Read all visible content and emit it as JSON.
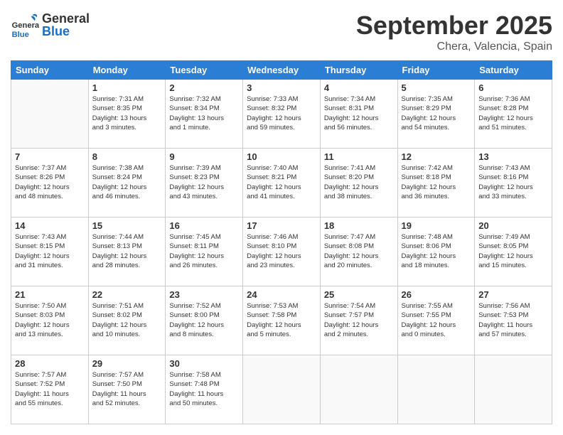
{
  "header": {
    "logo": {
      "general": "General",
      "blue": "Blue",
      "tagline": ""
    },
    "title": "September 2025",
    "subtitle": "Chera, Valencia, Spain"
  },
  "days_of_week": [
    "Sunday",
    "Monday",
    "Tuesday",
    "Wednesday",
    "Thursday",
    "Friday",
    "Saturday"
  ],
  "weeks": [
    [
      {
        "num": "",
        "info": ""
      },
      {
        "num": "1",
        "info": "Sunrise: 7:31 AM\nSunset: 8:35 PM\nDaylight: 13 hours\nand 3 minutes."
      },
      {
        "num": "2",
        "info": "Sunrise: 7:32 AM\nSunset: 8:34 PM\nDaylight: 13 hours\nand 1 minute."
      },
      {
        "num": "3",
        "info": "Sunrise: 7:33 AM\nSunset: 8:32 PM\nDaylight: 12 hours\nand 59 minutes."
      },
      {
        "num": "4",
        "info": "Sunrise: 7:34 AM\nSunset: 8:31 PM\nDaylight: 12 hours\nand 56 minutes."
      },
      {
        "num": "5",
        "info": "Sunrise: 7:35 AM\nSunset: 8:29 PM\nDaylight: 12 hours\nand 54 minutes."
      },
      {
        "num": "6",
        "info": "Sunrise: 7:36 AM\nSunset: 8:28 PM\nDaylight: 12 hours\nand 51 minutes."
      }
    ],
    [
      {
        "num": "7",
        "info": "Sunrise: 7:37 AM\nSunset: 8:26 PM\nDaylight: 12 hours\nand 48 minutes."
      },
      {
        "num": "8",
        "info": "Sunrise: 7:38 AM\nSunset: 8:24 PM\nDaylight: 12 hours\nand 46 minutes."
      },
      {
        "num": "9",
        "info": "Sunrise: 7:39 AM\nSunset: 8:23 PM\nDaylight: 12 hours\nand 43 minutes."
      },
      {
        "num": "10",
        "info": "Sunrise: 7:40 AM\nSunset: 8:21 PM\nDaylight: 12 hours\nand 41 minutes."
      },
      {
        "num": "11",
        "info": "Sunrise: 7:41 AM\nSunset: 8:20 PM\nDaylight: 12 hours\nand 38 minutes."
      },
      {
        "num": "12",
        "info": "Sunrise: 7:42 AM\nSunset: 8:18 PM\nDaylight: 12 hours\nand 36 minutes."
      },
      {
        "num": "13",
        "info": "Sunrise: 7:43 AM\nSunset: 8:16 PM\nDaylight: 12 hours\nand 33 minutes."
      }
    ],
    [
      {
        "num": "14",
        "info": "Sunrise: 7:43 AM\nSunset: 8:15 PM\nDaylight: 12 hours\nand 31 minutes."
      },
      {
        "num": "15",
        "info": "Sunrise: 7:44 AM\nSunset: 8:13 PM\nDaylight: 12 hours\nand 28 minutes."
      },
      {
        "num": "16",
        "info": "Sunrise: 7:45 AM\nSunset: 8:11 PM\nDaylight: 12 hours\nand 26 minutes."
      },
      {
        "num": "17",
        "info": "Sunrise: 7:46 AM\nSunset: 8:10 PM\nDaylight: 12 hours\nand 23 minutes."
      },
      {
        "num": "18",
        "info": "Sunrise: 7:47 AM\nSunset: 8:08 PM\nDaylight: 12 hours\nand 20 minutes."
      },
      {
        "num": "19",
        "info": "Sunrise: 7:48 AM\nSunset: 8:06 PM\nDaylight: 12 hours\nand 18 minutes."
      },
      {
        "num": "20",
        "info": "Sunrise: 7:49 AM\nSunset: 8:05 PM\nDaylight: 12 hours\nand 15 minutes."
      }
    ],
    [
      {
        "num": "21",
        "info": "Sunrise: 7:50 AM\nSunset: 8:03 PM\nDaylight: 12 hours\nand 13 minutes."
      },
      {
        "num": "22",
        "info": "Sunrise: 7:51 AM\nSunset: 8:02 PM\nDaylight: 12 hours\nand 10 minutes."
      },
      {
        "num": "23",
        "info": "Sunrise: 7:52 AM\nSunset: 8:00 PM\nDaylight: 12 hours\nand 8 minutes."
      },
      {
        "num": "24",
        "info": "Sunrise: 7:53 AM\nSunset: 7:58 PM\nDaylight: 12 hours\nand 5 minutes."
      },
      {
        "num": "25",
        "info": "Sunrise: 7:54 AM\nSunset: 7:57 PM\nDaylight: 12 hours\nand 2 minutes."
      },
      {
        "num": "26",
        "info": "Sunrise: 7:55 AM\nSunset: 7:55 PM\nDaylight: 12 hours\nand 0 minutes."
      },
      {
        "num": "27",
        "info": "Sunrise: 7:56 AM\nSunset: 7:53 PM\nDaylight: 11 hours\nand 57 minutes."
      }
    ],
    [
      {
        "num": "28",
        "info": "Sunrise: 7:57 AM\nSunset: 7:52 PM\nDaylight: 11 hours\nand 55 minutes."
      },
      {
        "num": "29",
        "info": "Sunrise: 7:57 AM\nSunset: 7:50 PM\nDaylight: 11 hours\nand 52 minutes."
      },
      {
        "num": "30",
        "info": "Sunrise: 7:58 AM\nSunset: 7:48 PM\nDaylight: 11 hours\nand 50 minutes."
      },
      {
        "num": "",
        "info": ""
      },
      {
        "num": "",
        "info": ""
      },
      {
        "num": "",
        "info": ""
      },
      {
        "num": "",
        "info": ""
      }
    ]
  ]
}
